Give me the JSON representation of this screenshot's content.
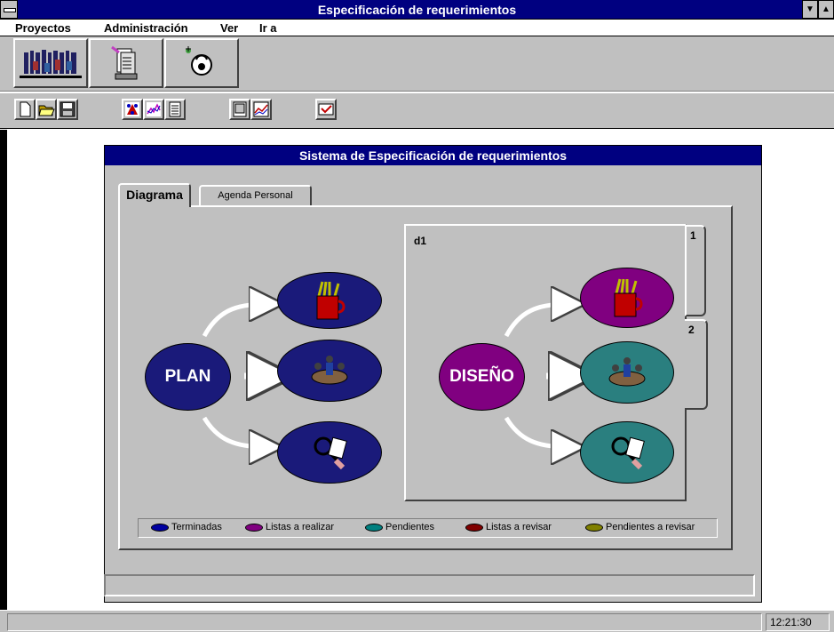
{
  "window": {
    "title": "Especificación de requerimientos"
  },
  "menu": {
    "items": [
      "Proyectos",
      "Administración",
      "Ver",
      "Ir a"
    ]
  },
  "toolbar_large": {
    "icons": [
      "people-icon",
      "documents-icon",
      "helpdesk-icon"
    ]
  },
  "toolbar_small": {
    "icons": [
      "new-icon",
      "open-icon",
      "save-icon",
      "diagram-icon",
      "chart-icon",
      "list-icon",
      "report-icon",
      "graph-icon",
      "check-icon"
    ]
  },
  "panel": {
    "title": "Sistema de Especificación de requerimientos",
    "tabs": [
      "Diagrama",
      "Agenda Personal"
    ],
    "diagram": {
      "left_node": "PLAN",
      "sub_label": "d1",
      "right_node": "DISEÑO",
      "vertical_tabs": [
        "1",
        "2"
      ]
    },
    "legend": [
      {
        "label": "Terminadas",
        "color": "#0000a0"
      },
      {
        "label": "Listas a realizar",
        "color": "#800080"
      },
      {
        "label": "Pendientes",
        "color": "#008080"
      },
      {
        "label": "Listas a revisar",
        "color": "#800000"
      },
      {
        "label": "Pendientes a revisar",
        "color": "#808000"
      }
    ]
  },
  "colors": {
    "plan_nodes": "#1a1a7a",
    "purple_nodes": "#800080",
    "teal_nodes": "#2a7f7f"
  },
  "statusbar": {
    "time": "12:21:30"
  }
}
